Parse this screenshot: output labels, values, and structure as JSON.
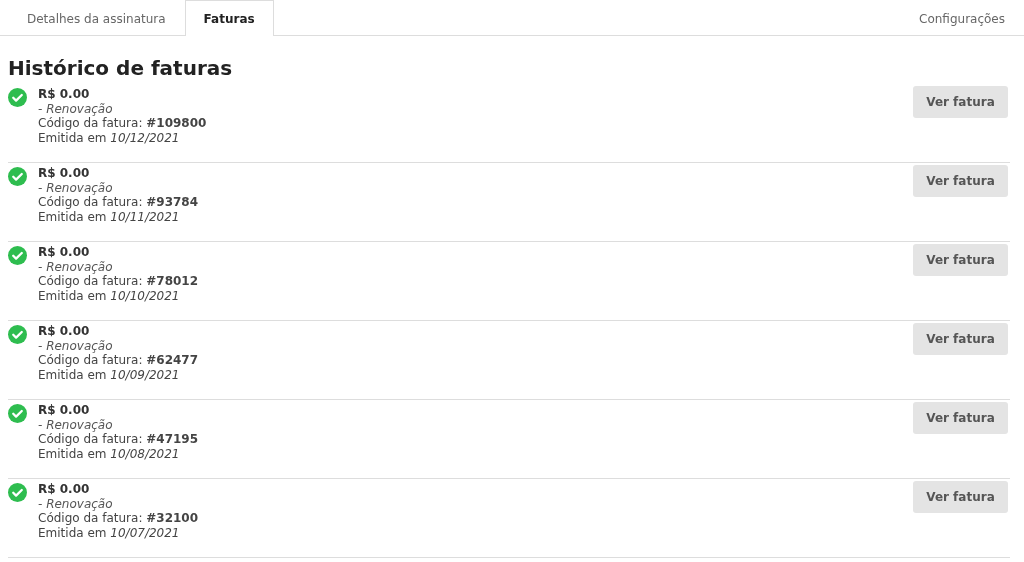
{
  "tabs": [
    {
      "label": "Detalhes da assinatura",
      "selected": false
    },
    {
      "label": "Faturas",
      "selected": true
    }
  ],
  "settings_tab": {
    "label": "Configurações",
    "selected": false
  },
  "title": "Histórico de faturas",
  "invoices": [
    {
      "paid": true,
      "amount": "R$ 0.00",
      "type": "- Renovação",
      "code": "Código da fatura: **#109800**",
      "issued": "Emitida em *10/12/2021*",
      "button": "Ver fatura"
    },
    {
      "paid": true,
      "amount": "R$ 0.00",
      "type": "- Renovação",
      "code": "Código da fatura: **#93784**",
      "issued": "Emitida em *10/11/2021*",
      "button": "Ver fatura"
    },
    {
      "paid": true,
      "amount": "R$ 0.00",
      "type": "- Renovação",
      "code": "Código da fatura: **#78012**",
      "issued": "Emitida em *10/10/2021*",
      "button": "Ver fatura"
    },
    {
      "paid": true,
      "amount": "R$ 0.00",
      "type": "- Renovação",
      "code": "Código da fatura: **#62477**",
      "issued": "Emitida em *10/09/2021*",
      "button": "Ver fatura"
    },
    {
      "paid": true,
      "amount": "R$ 0.00",
      "type": "- Renovação",
      "code": "Código da fatura: **#47195**",
      "issued": "Emitida em *10/08/2021*",
      "button": "Ver fatura"
    },
    {
      "paid": true,
      "amount": "R$ 0.00",
      "type": "- Renovação",
      "code": "Código da fatura: **#32100**",
      "issued": "Emitida em *10/07/2021*",
      "button": "Ver fatura"
    }
  ]
}
